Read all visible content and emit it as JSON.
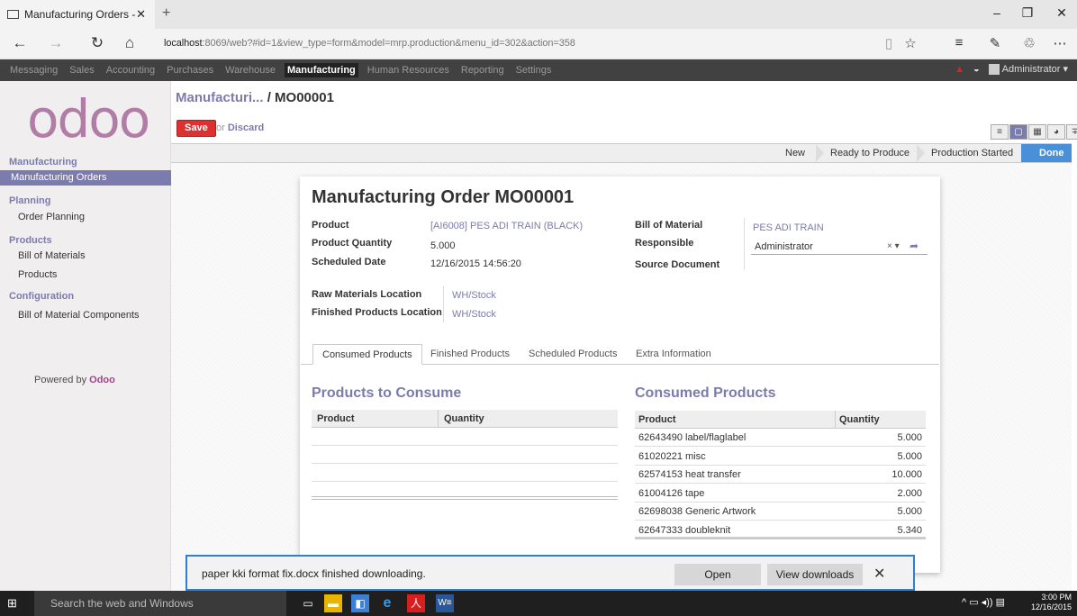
{
  "browser": {
    "tab_title": "Manufacturing Orders -",
    "url_host": "localhost",
    "url_rest": ":8069/web?#id=1&view_type=form&model=mrp.production&menu_id=302&action=358"
  },
  "topmenu": {
    "items": [
      "Messaging",
      "Sales",
      "Accounting",
      "Purchases",
      "Warehouse",
      "Manufacturing",
      "Human Resources",
      "Reporting",
      "Settings"
    ],
    "active": "Manufacturing",
    "user": "Administrator"
  },
  "sidebar": {
    "logo": "odoo",
    "sections": [
      {
        "header": "Manufacturing",
        "items": [
          "Manufacturing Orders"
        ]
      },
      {
        "header": "Planning",
        "items": [
          "Order Planning"
        ]
      },
      {
        "header": "Products",
        "items": [
          "Bill of Materials",
          "Products"
        ]
      },
      {
        "header": "Configuration",
        "items": [
          "Bill of Material Components"
        ]
      }
    ],
    "powered_prefix": "Powered by",
    "powered_brand": "Odoo"
  },
  "header": {
    "breadcrumb_parent": "Manufacturi...",
    "breadcrumb_sep": "/",
    "breadcrumb_current": "MO00001",
    "save": "Save",
    "or": "or",
    "discard": "Discard"
  },
  "stages": [
    "New",
    "Ready to Produce",
    "Production Started",
    "Done"
  ],
  "form": {
    "title": "Manufacturing Order MO00001",
    "product_label": "Product",
    "product_value": "[AI6008] PES ADI TRAIN (BLACK)",
    "qty_label": "Product Quantity",
    "qty_value": "5.000",
    "date_label": "Scheduled Date",
    "date_value": "12/16/2015 14:56:20",
    "bom_label": "Bill of Material",
    "bom_value": "PES ADI TRAIN",
    "resp_label": "Responsible",
    "resp_value": "Administrator",
    "source_label": "Source Document",
    "raw_loc_label": "Raw Materials Location",
    "raw_loc_value": "WH/Stock",
    "fin_loc_label": "Finished Products Location",
    "fin_loc_value": "WH/Stock"
  },
  "tabs": [
    "Consumed Products",
    "Finished Products",
    "Scheduled Products",
    "Extra Information"
  ],
  "to_consume": {
    "title": "Products to Consume",
    "columns": [
      "Product",
      "Quantity"
    ]
  },
  "consumed": {
    "title": "Consumed Products",
    "columns": [
      "Product",
      "Quantity"
    ],
    "rows": [
      {
        "product": "62643490 label/flaglabel",
        "qty": "5.000"
      },
      {
        "product": "61020221 misc",
        "qty": "5.000"
      },
      {
        "product": "62574153 heat transfer",
        "qty": "10.000"
      },
      {
        "product": "61004126 tape",
        "qty": "2.000"
      },
      {
        "product": "62698038 Generic Artwork",
        "qty": "5.000"
      },
      {
        "product": "62647333 doubleknit",
        "qty": "5.340"
      }
    ]
  },
  "download": {
    "message": "paper kki format fix.docx finished downloading.",
    "open": "Open",
    "view": "View downloads"
  },
  "taskbar": {
    "search": "Search the web and Windows",
    "time": "3:00 PM",
    "date": "12/16/2015"
  }
}
